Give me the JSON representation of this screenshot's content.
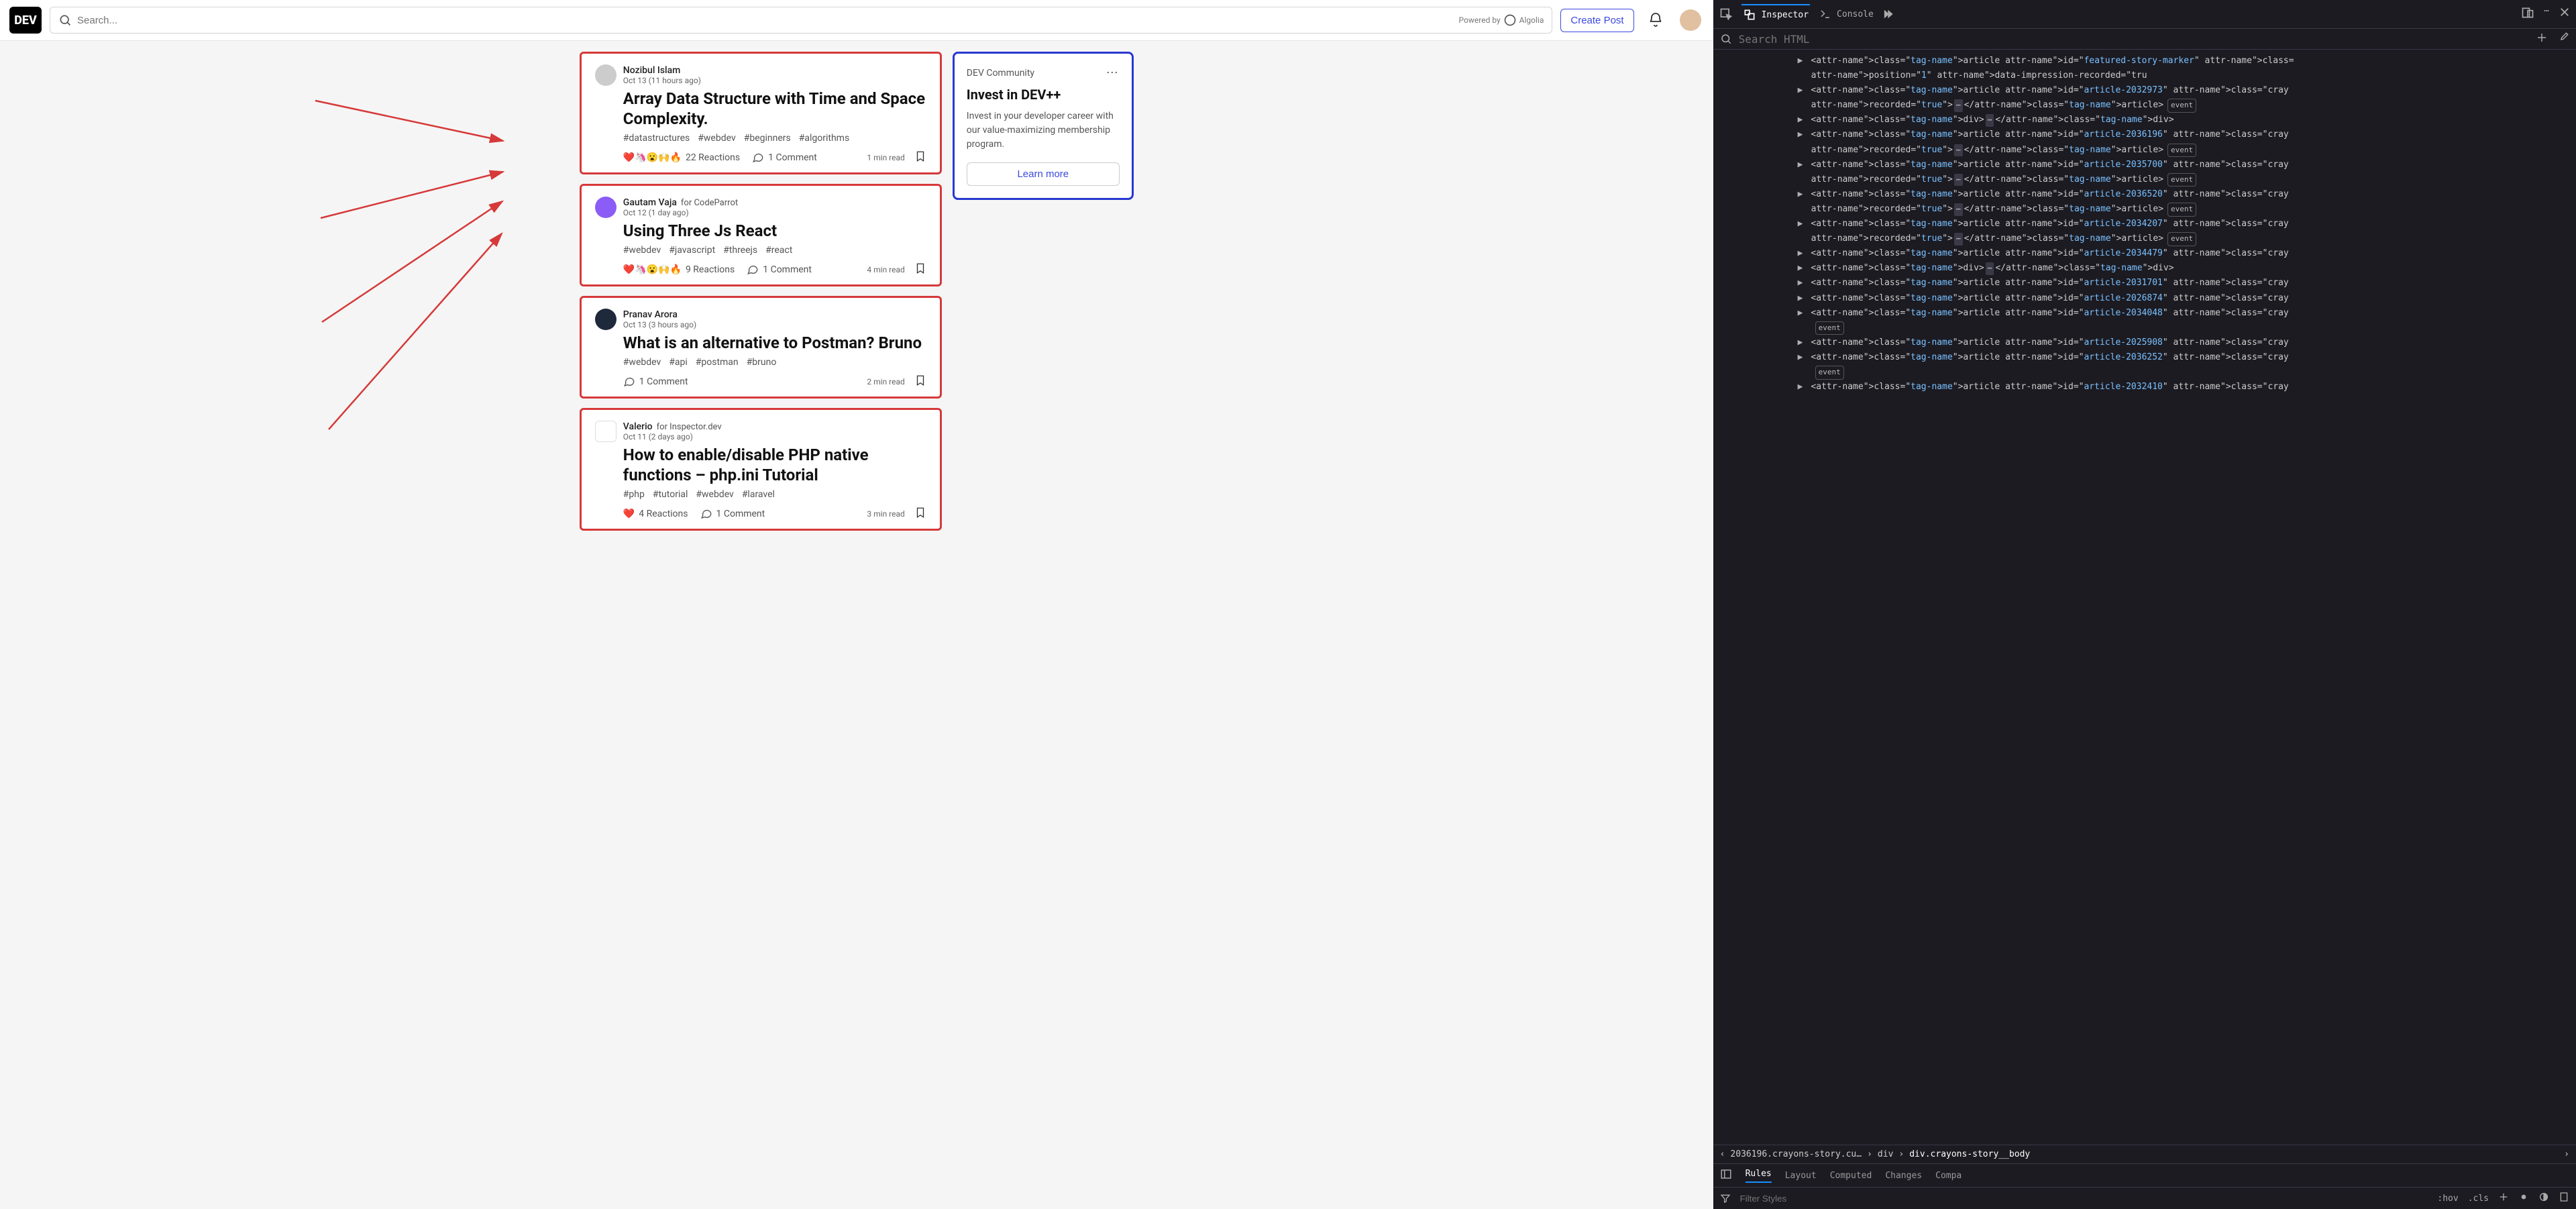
{
  "topbar": {
    "logo": "DEV",
    "search_placeholder": "Search...",
    "powered_by": "Powered by",
    "powered_vendor": "Algolia",
    "create_post": "Create Post"
  },
  "feed": [
    {
      "author": "Nozibul Islam",
      "date": "Oct 13 (11 hours ago)",
      "title": "Array Data Structure with Time and Space Complexity.",
      "tags": [
        "#datastructures",
        "#webdev",
        "#beginners",
        "#algorithms"
      ],
      "reaction_emojis": "❤️🦄😮🙌🔥",
      "reactions": "22 Reactions",
      "comments": "1 Comment",
      "read_time": "1 min read"
    },
    {
      "author": "Gautam Vaja",
      "org": "for CodeParrot",
      "date": "Oct 12 (1 day ago)",
      "title": "Using Three Js React",
      "tags": [
        "#webdev",
        "#javascript",
        "#threejs",
        "#react"
      ],
      "reaction_emojis": "❤️🦄😮🙌🔥",
      "reactions": "9 Reactions",
      "comments": "1 Comment",
      "read_time": "4 min read"
    },
    {
      "author": "Pranav Arora",
      "date": "Oct 13 (3 hours ago)",
      "title": "What is an alternative to Postman? Bruno",
      "tags": [
        "#webdev",
        "#api",
        "#postman",
        "#bruno"
      ],
      "comments": "1 Comment",
      "read_time": "2 min read"
    },
    {
      "author": "Valerio",
      "org": "for Inspector.dev",
      "date": "Oct 11 (2 days ago)",
      "title": "How to enable/disable PHP native functions – php.ini Tutorial",
      "tags": [
        "#php",
        "#tutorial",
        "#webdev",
        "#laravel"
      ],
      "reaction_emojis": "❤️",
      "reactions": "4 Reactions",
      "comments": "1 Comment",
      "read_time": "3 min read"
    }
  ],
  "promo": {
    "header": "DEV Community",
    "title": "Invest in DEV++",
    "body": "Invest in your developer career with our value-maximizing membership program.",
    "button": "Learn more"
  },
  "devtools": {
    "tabs": {
      "inspector": "Inspector",
      "console": "Console"
    },
    "search_placeholder": "Search HTML",
    "tree": [
      {
        "caret": "▶",
        "text": "<article id=\"featured-story-marker\" class=",
        "cont": "position=\"1\" data-impression-recorded=\"tru"
      },
      {
        "caret": "▶",
        "text": "<article id=\"article-2032973\" class=\"cray",
        "cont": "recorded=\"true\">⋯</article>",
        "evt": true
      },
      {
        "caret": "▶",
        "text": "<div>⋯</div>"
      },
      {
        "caret": "▶",
        "text": "<article id=\"article-2036196\" class=\"cray",
        "cont": "recorded=\"true\">⋯</article>",
        "evt": true
      },
      {
        "caret": "▶",
        "text": "<article id=\"article-2035700\" class=\"cray",
        "cont": "recorded=\"true\">⋯</article>",
        "evt": true
      },
      {
        "caret": "▶",
        "text": "<article id=\"article-2036520\" class=\"cray",
        "cont": "recorded=\"true\">⋯</article>",
        "evt": true
      },
      {
        "caret": "▶",
        "text": "<article id=\"article-2034207\" class=\"cray",
        "cont": "recorded=\"true\">⋯</article>",
        "evt": true
      },
      {
        "caret": "▶",
        "text": "<article id=\"article-2034479\" class=\"cray"
      },
      {
        "caret": "▶",
        "text": "<div>⋯</div>"
      },
      {
        "caret": "▶",
        "text": "<article id=\"article-2031701\" class=\"cray"
      },
      {
        "caret": "▶",
        "text": "<article id=\"article-2026874\" class=\"cray"
      },
      {
        "caret": "▶",
        "text": "<article id=\"article-2034048\" class=\"cray",
        "evt_below": true
      },
      {
        "caret": "▶",
        "text": "<article id=\"article-2025908\" class=\"cray"
      },
      {
        "caret": "▶",
        "text": "<article id=\"article-2036252\" class=\"cray",
        "evt_below": true
      },
      {
        "caret": "▶",
        "text": "<article id=\"article-2032410\" class=\"cray"
      }
    ],
    "breadcrumb": [
      "2036196.crayons-story.cu…",
      "div",
      "div.crayons-story__body"
    ],
    "bottom_tabs": [
      "Rules",
      "Layout",
      "Computed",
      "Changes",
      "Compa"
    ],
    "filter_placeholder": "Filter Styles",
    "filter_icons": [
      ":hov",
      ".cls"
    ]
  }
}
